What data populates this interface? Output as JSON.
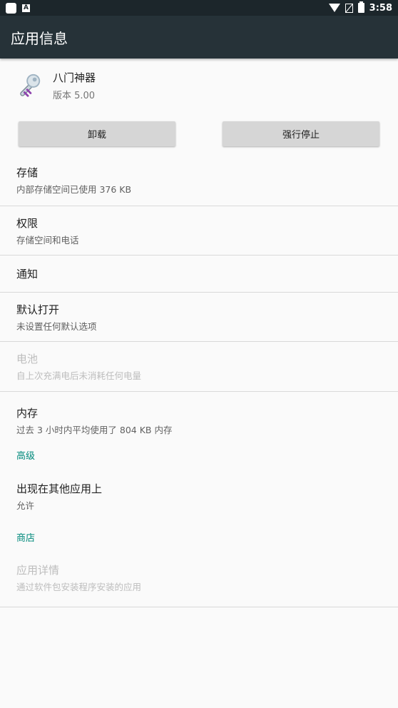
{
  "status_bar": {
    "time": "3:58"
  },
  "app_bar": {
    "title": "应用信息"
  },
  "app": {
    "name": "八门神器",
    "version": "版本 5.00"
  },
  "buttons": {
    "uninstall": "卸载",
    "force_stop": "强行停止"
  },
  "items": {
    "storage": {
      "title": "存储",
      "summary": "内部存储空间已使用 376 KB"
    },
    "permissions": {
      "title": "权限",
      "summary": "存储空间和电话"
    },
    "notifications": {
      "title": "通知"
    },
    "open_by_default": {
      "title": "默认打开",
      "summary": "未设置任何默认选项"
    },
    "battery": {
      "title": "电池",
      "summary": "自上次充满电后未消耗任何电量"
    },
    "memory": {
      "title": "内存",
      "summary": "过去 3 小时内平均使用了 804 KB 内存"
    },
    "draw_over": {
      "title": "出现在其他应用上",
      "summary": "允许"
    },
    "app_details": {
      "title": "应用详情",
      "summary": "通过软件包安装程序安装的应用"
    }
  },
  "sections": {
    "advanced": "高级",
    "store": "商店"
  },
  "colors": {
    "app_bar": "#263238",
    "status_bar": "#1c262b",
    "accent": "#00897b"
  }
}
